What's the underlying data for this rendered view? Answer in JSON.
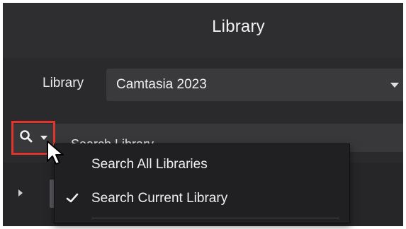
{
  "window": {
    "title": "Library"
  },
  "library_selector": {
    "label": "Library",
    "selected_value": "Camtasia 2023"
  },
  "search": {
    "placeholder": "Search Library...",
    "button_icon": "search-icon",
    "dropdown_icon": "chevron-down-icon",
    "highlight_color": "#e0352b"
  },
  "search_menu": {
    "items": [
      {
        "label": "Search All Libraries",
        "checked": false
      },
      {
        "label": "Search Current Library",
        "checked": true
      }
    ]
  },
  "colors": {
    "background": "#252527",
    "text": "#f0f0f0",
    "menu_background": "#202022"
  }
}
